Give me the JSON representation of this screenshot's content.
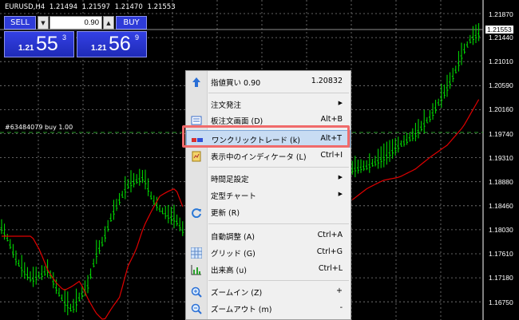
{
  "symbol_header": {
    "symbol": "EURUSD,H4",
    "prices": [
      "1.21494",
      "1.21597",
      "1.21470",
      "1.21553"
    ]
  },
  "trade_panel": {
    "sell_label": "SELL",
    "buy_label": "BUY",
    "volume": "0.90",
    "sell_price_prefix": "1.21",
    "sell_price_big": "55",
    "sell_price_sup": "3",
    "buy_price_prefix": "1.21",
    "buy_price_big": "56",
    "buy_price_sup": "9"
  },
  "order_label": "#63484079 buy 1.00",
  "price_axis": {
    "labels": [
      "1.21870",
      "1.21440",
      "1.21010",
      "1.20590",
      "1.20160",
      "1.19740",
      "1.19310",
      "1.18880",
      "1.18460",
      "1.18030",
      "1.17610",
      "1.17180",
      "1.16750"
    ],
    "current_price": "1.21553"
  },
  "context_menu": {
    "items": [
      {
        "label": "指値買い 0.90",
        "shortcut": "1.20832",
        "submenu": false,
        "icon": "arrow-up-icon"
      },
      {
        "label": "注文発注",
        "shortcut": "",
        "submenu": true,
        "icon": ""
      },
      {
        "label": "板注文画面 (D)",
        "shortcut": "Alt+B",
        "submenu": false,
        "icon": "order-book-icon"
      },
      {
        "label": "ワンクリックトレード (k)",
        "shortcut": "Alt+T",
        "submenu": false,
        "icon": "one-click-trade-icon"
      },
      {
        "label": "表示中のインディケータ (L)",
        "shortcut": "Ctrl+I",
        "submenu": false,
        "icon": "indicators-list-icon"
      },
      {
        "label": "時間足設定",
        "shortcut": "",
        "submenu": true,
        "icon": ""
      },
      {
        "label": "定型チャート",
        "shortcut": "",
        "submenu": true,
        "icon": ""
      },
      {
        "label": "更新 (R)",
        "shortcut": "",
        "submenu": false,
        "icon": "refresh-icon"
      },
      {
        "label": "自動調整 (A)",
        "shortcut": "Ctrl+A",
        "submenu": false,
        "icon": ""
      },
      {
        "label": "グリッド (G)",
        "shortcut": "Ctrl+G",
        "submenu": false,
        "icon": "grid-icon"
      },
      {
        "label": "出来高 (u)",
        "shortcut": "Ctrl+L",
        "submenu": false,
        "icon": "volumes-icon"
      },
      {
        "label": "ズームイン (Z)",
        "shortcut": "+",
        "submenu": false,
        "icon": "zoom-in-icon"
      },
      {
        "label": "ズームアウト (m)",
        "shortcut": "-",
        "submenu": false,
        "icon": "zoom-out-icon"
      }
    ],
    "highlighted_index": 3
  },
  "colors": {
    "background": "#000000",
    "candle": "#00e600",
    "moving_average": "#e00000",
    "grid": "#7f7f7f",
    "highlight_frame": "#f06a6a",
    "panel_blue": "#2e3bd8"
  }
}
